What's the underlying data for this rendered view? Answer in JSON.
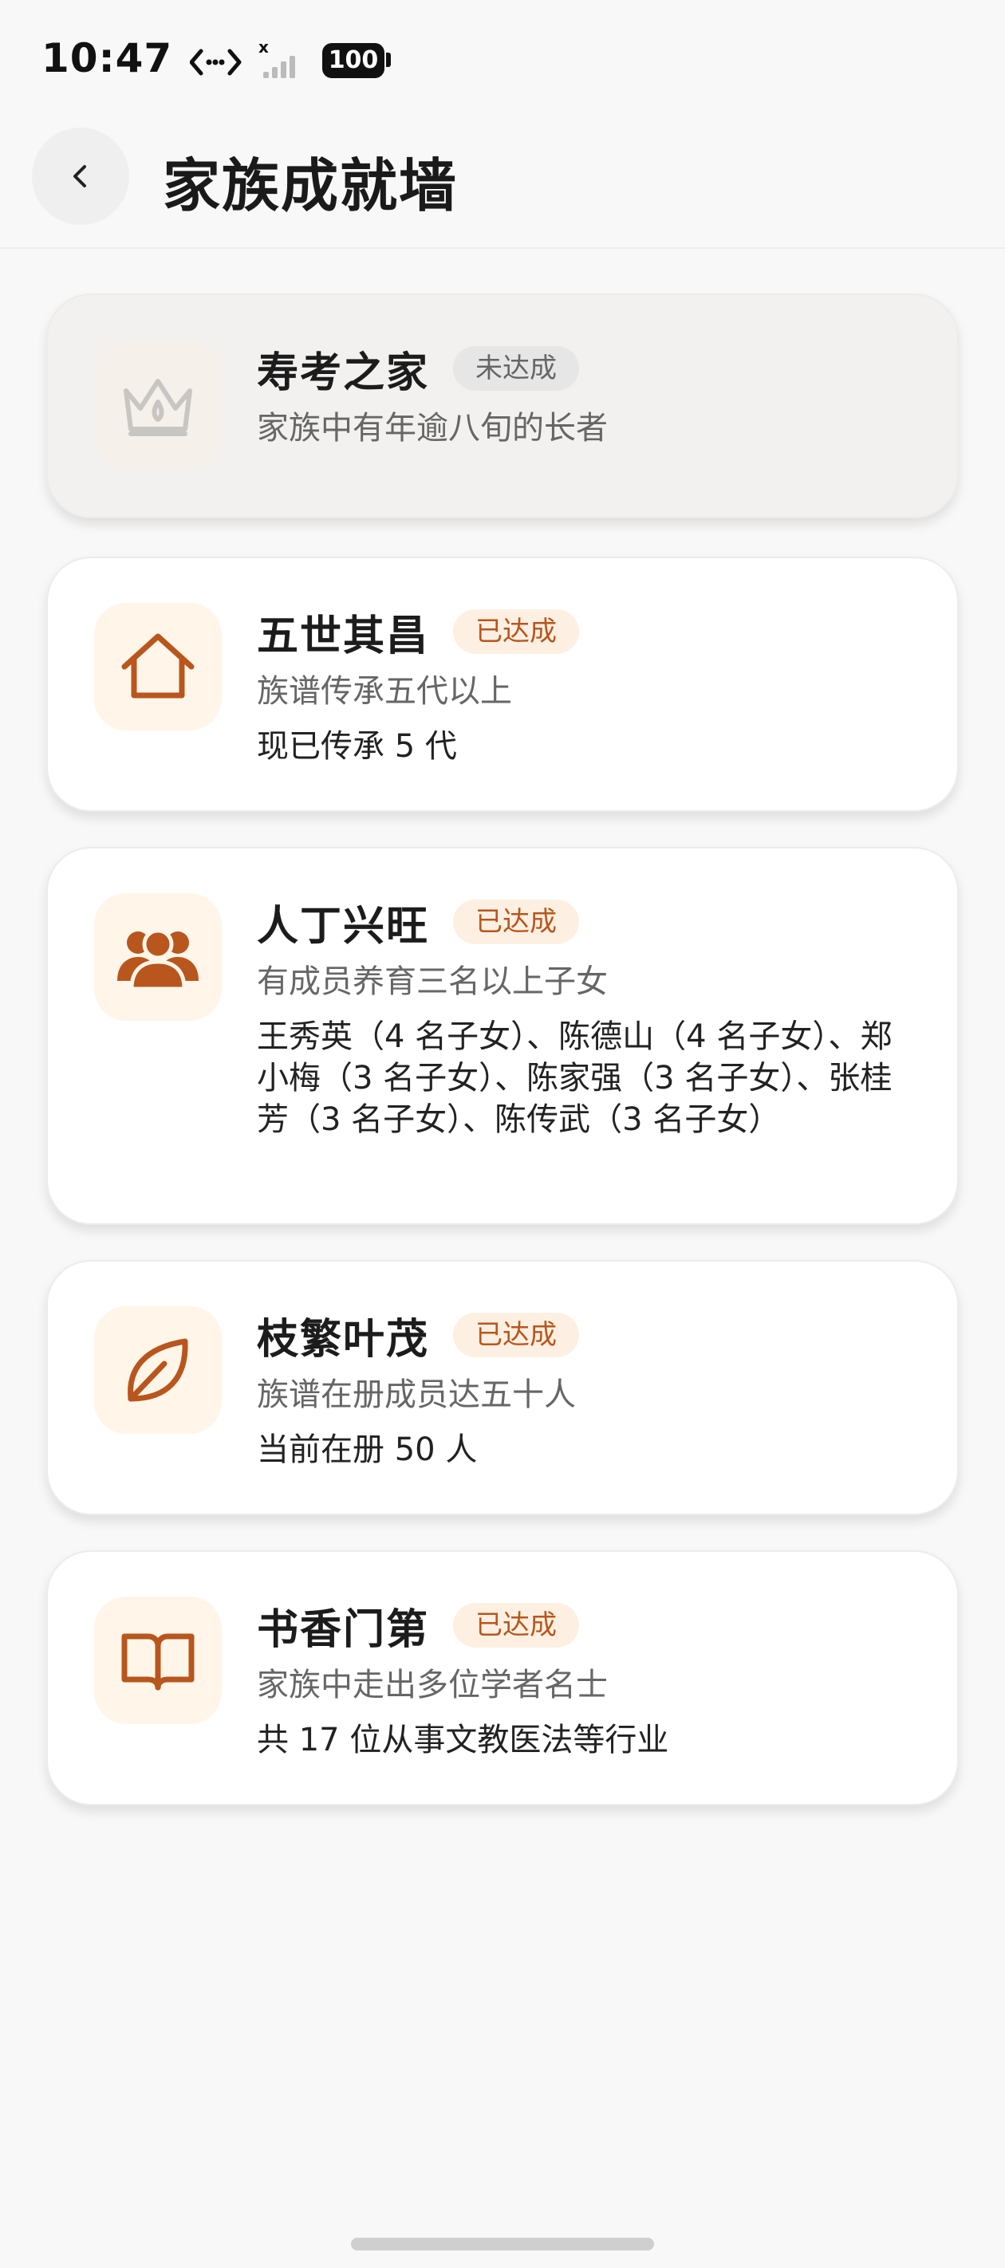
{
  "status_bar": {
    "time": "10:47",
    "battery": "100"
  },
  "header": {
    "title": "家族成就墙"
  },
  "achievements": [
    {
      "title": "寿考之家",
      "status": "未达成",
      "desc": "家族中有年逾八旬的长者",
      "detail": "",
      "icon": "crown-icon"
    },
    {
      "title": "五世其昌",
      "status": "已达成",
      "desc": "族谱传承五代以上",
      "detail": "现已传承 5 代",
      "icon": "house-icon"
    },
    {
      "title": "人丁兴旺",
      "status": "已达成",
      "desc": "有成员养育三名以上子女",
      "detail": "王秀英（4 名子女）、陈德山（4 名子女）、郑小梅（3 名子女）、陈家强（3 名子女）、张桂芳（3 名子女）、陈传武（3 名子女）",
      "icon": "people-icon"
    },
    {
      "title": "枝繁叶茂",
      "status": "已达成",
      "desc": "族谱在册成员达五十人",
      "detail": "当前在册 50 人",
      "icon": "leaf-icon"
    },
    {
      "title": "书香门第",
      "status": "已达成",
      "desc": "家族中走出多位学者名士",
      "detail": "共 17 位从事文教医法等行业",
      "icon": "book-icon"
    }
  ],
  "colors": {
    "accent": "#b8561d",
    "badge_bg": "#fdf0e2",
    "icon_bg": "#fff5e9",
    "locked_bg": "#f2f1ef"
  }
}
